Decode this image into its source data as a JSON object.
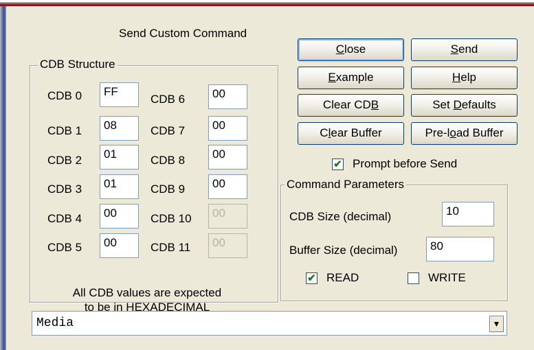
{
  "title": "Send Custom Command",
  "cdb_structure": {
    "legend": "CDB Structure",
    "fields": [
      {
        "label": "CDB 0",
        "value": "FF",
        "enabled": true
      },
      {
        "label": "CDB 1",
        "value": "08",
        "enabled": true
      },
      {
        "label": "CDB 2",
        "value": "01",
        "enabled": true
      },
      {
        "label": "CDB 3",
        "value": "01",
        "enabled": true
      },
      {
        "label": "CDB 4",
        "value": "00",
        "enabled": true
      },
      {
        "label": "CDB 5",
        "value": "00",
        "enabled": true
      },
      {
        "label": "CDB 6",
        "value": "00",
        "enabled": true
      },
      {
        "label": "CDB 7",
        "value": "00",
        "enabled": true
      },
      {
        "label": "CDB 8",
        "value": "00",
        "enabled": true
      },
      {
        "label": "CDB 9",
        "value": "00",
        "enabled": true
      },
      {
        "label": "CDB 10",
        "value": "00",
        "enabled": false
      },
      {
        "label": "CDB 11",
        "value": "00",
        "enabled": false
      }
    ],
    "note_line1": "All CDB values are expected",
    "note_line2": "to be in HEXADECIMAL"
  },
  "buttons": {
    "close": {
      "pre": "",
      "key": "C",
      "post": "lose"
    },
    "send": {
      "pre": "",
      "key": "S",
      "post": "end"
    },
    "example": {
      "pre": "",
      "key": "E",
      "post": "xample"
    },
    "help": {
      "pre": "",
      "key": "H",
      "post": "elp"
    },
    "clear_cdb": {
      "pre": "Clear CD",
      "key": "B",
      "post": ""
    },
    "set_defaults": {
      "pre": "Set ",
      "key": "D",
      "post": "efaults"
    },
    "clear_buffer": {
      "pre": "C",
      "key": "l",
      "post": "ear Buffer"
    },
    "preload_buffer": {
      "pre": "Pre-l",
      "key": "o",
      "post": "ad Buffer"
    }
  },
  "prompt_before_send": {
    "label": "Prompt before Send",
    "checked": true
  },
  "command_parameters": {
    "legend": "Command Parameters",
    "cdb_size_label": "CDB Size (decimal)",
    "cdb_size_value": "10",
    "buffer_size_label": "Buffer Size (decimal)",
    "buffer_size_value": "80",
    "read": {
      "label": "READ",
      "checked": true
    },
    "write": {
      "label": "WRITE",
      "checked": false
    }
  },
  "media_combo": {
    "value": "Media"
  },
  "icons": {
    "dropdown": "chevron-down-icon",
    "check": "checkmark-icon"
  }
}
